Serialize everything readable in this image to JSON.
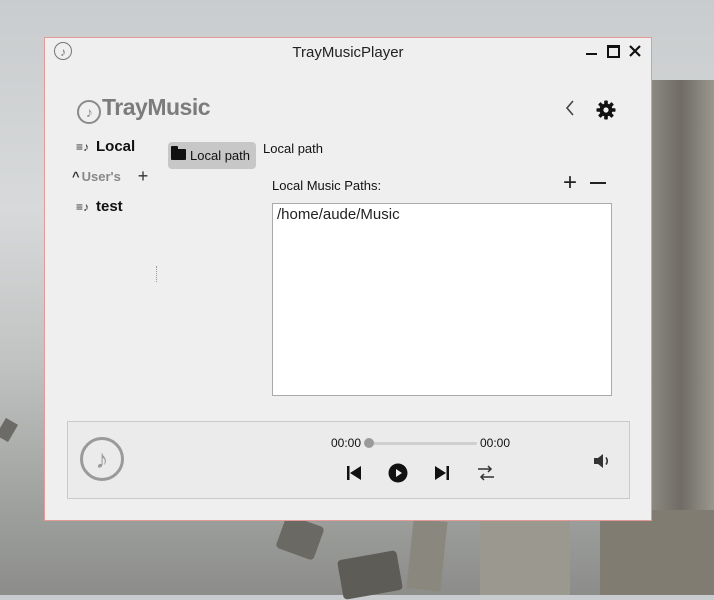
{
  "window": {
    "title": "TrayMusicPlayer"
  },
  "brand": {
    "name": "TrayMusic"
  },
  "sidebar": {
    "local_label": "Local",
    "users_label": "User's",
    "playlists": [
      {
        "label": "test"
      }
    ]
  },
  "main": {
    "tab_label": "Local path",
    "heading": "Local path",
    "paths_label": "Local Music Paths:",
    "paths": [
      "/home/aude/Music"
    ]
  },
  "player": {
    "current_time": "00:00",
    "total_time": "00:00",
    "progress": 0
  },
  "icons": {
    "app": "music-note-icon",
    "back": "chevron-left-icon",
    "settings": "gear-icon",
    "playlist": "playlist-icon",
    "folder": "folder-icon",
    "add": "plus-icon",
    "remove": "minus-icon",
    "prev": "skip-previous-icon",
    "play": "play-icon",
    "next": "skip-next-icon",
    "mode": "repeat-icon",
    "volume": "volume-icon"
  },
  "colors": {
    "window_border": "#e59a9a",
    "active_tab": "#c7c7c7",
    "brand": "#7c7c7c"
  }
}
